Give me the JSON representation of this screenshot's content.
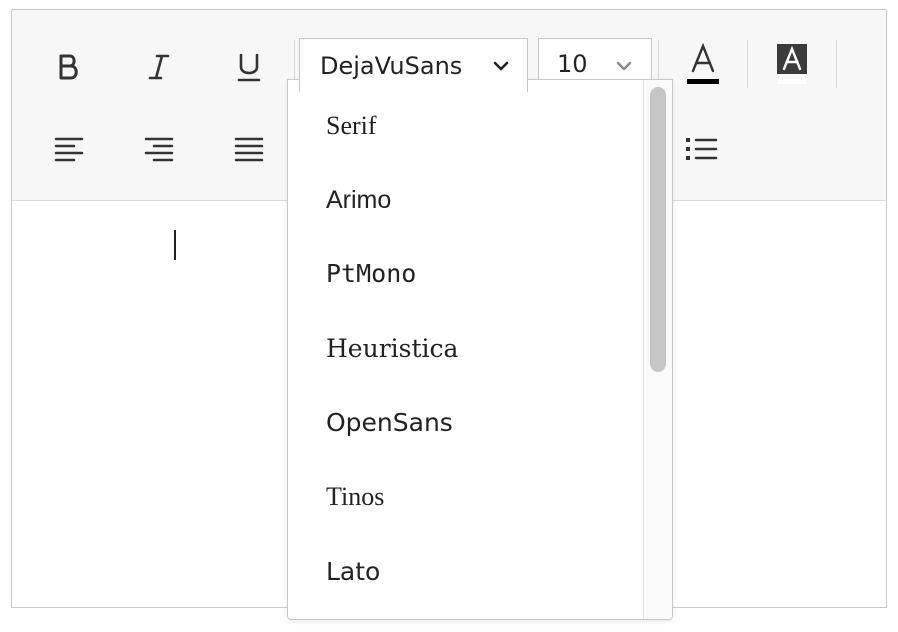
{
  "toolbar": {
    "bold_icon": "bold-icon",
    "italic_icon": "italic-icon",
    "underline_icon": "underline-icon",
    "font_family": {
      "selected": "DejaVuSans"
    },
    "font_size": {
      "selected": "10"
    },
    "text_color_icon": "text-color-icon",
    "highlight_icon": "highlight-color-icon",
    "align_icons": [
      "align-left-icon",
      "align-right-icon",
      "justify-icon"
    ],
    "list_icon": "bulleted-list-icon"
  },
  "font_menu": {
    "items": [
      {
        "label": "Serif"
      },
      {
        "label": "Arimo"
      },
      {
        "label": "PtMono"
      },
      {
        "label": "Heuristica"
      },
      {
        "label": "OpenSans"
      },
      {
        "label": "Tinos"
      },
      {
        "label": "Lato"
      }
    ]
  },
  "colors": {
    "text_color_bar": "#000000",
    "toolbar_bg": "#f7f7f7",
    "scrollbar_thumb": "#c6c6c6"
  }
}
